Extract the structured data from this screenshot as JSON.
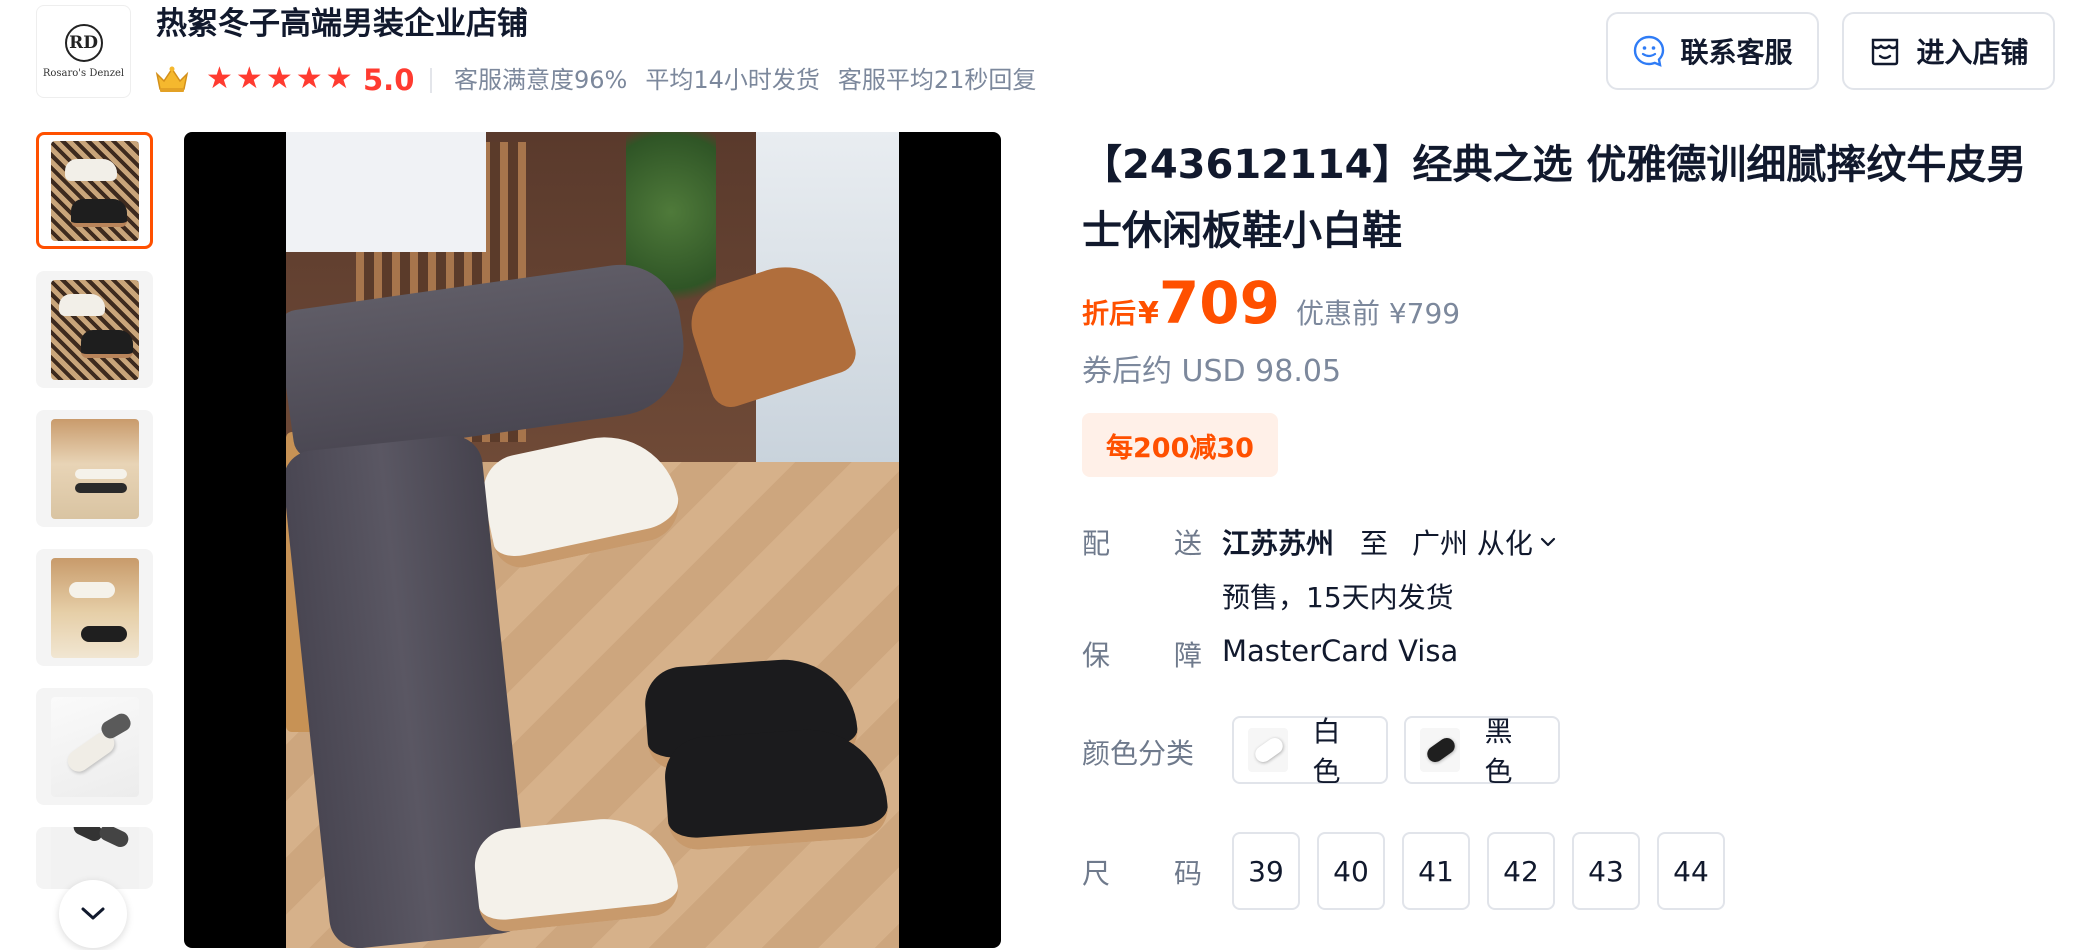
{
  "store": {
    "name": "热絮冬子高端男装企业店铺",
    "logo_text": "Rosaro's Denzel",
    "rating": "5.0",
    "stats": [
      "客服满意度96%",
      "平均14小时发货",
      "客服平均21秒回复"
    ]
  },
  "header_buttons": {
    "contact": "联系客服",
    "enter_shop": "进入店铺"
  },
  "product": {
    "title": "【243612114】经典之选 优雅德训细腻摔纹牛皮男士休闲板鞋小白鞋",
    "price_label": "折后",
    "currency": "¥",
    "price": "709",
    "price_before": "优惠前 ¥799",
    "usd": "券后约 USD 98.05",
    "promo": "每200减30"
  },
  "shipping": {
    "label_1": "配",
    "label_2": "送",
    "from": "江苏苏州",
    "to_word": "至",
    "destination": "广州 从化",
    "presale": "预售，15天内发货"
  },
  "guarantee": {
    "label_1": "保",
    "label_2": "障",
    "value": "MasterCard Visa"
  },
  "color": {
    "label": "颜色分类",
    "options": [
      "白色",
      "黑色"
    ]
  },
  "size": {
    "label_1": "尺",
    "label_2": "码",
    "options": [
      "39",
      "40",
      "41",
      "42",
      "43",
      "44"
    ]
  },
  "colors": {
    "accent": "#ff5000",
    "star": "#ff3b30",
    "text": "#11192d",
    "muted": "#7c889c"
  }
}
